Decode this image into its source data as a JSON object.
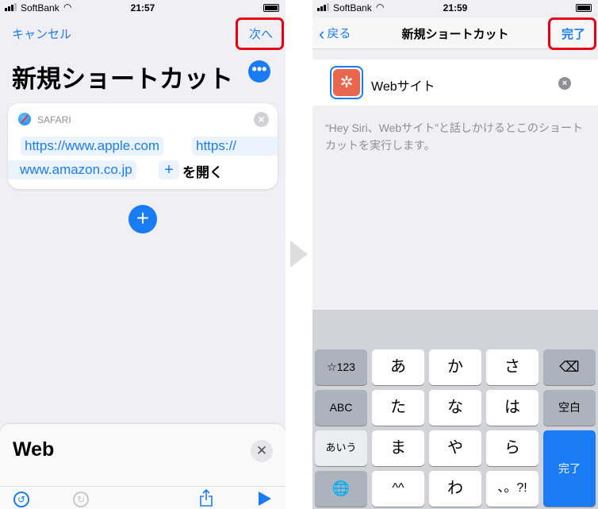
{
  "left": {
    "status": {
      "carrier": "SoftBank",
      "time": "21:57"
    },
    "nav": {
      "cancel": "キャンセル",
      "next": "次へ"
    },
    "title": "新規ショートカット",
    "more_icon": "ellipsis-icon",
    "action": {
      "app": "SAFARI",
      "tokens": [
        "https://www.apple.com",
        "https://",
        "www.amazon.co.jp",
        "+"
      ],
      "verb": "を開く"
    },
    "add_icon": "plus-icon",
    "sheet": {
      "title": "Web",
      "toolbar": [
        "undo-icon",
        "redo-icon",
        "share-icon",
        "play-icon"
      ]
    }
  },
  "right": {
    "status": {
      "carrier": "SoftBank",
      "time": "21:59"
    },
    "nav": {
      "back": "戻る",
      "title": "新規ショートカット",
      "done": "完了"
    },
    "shortcut_name": "Webサイト",
    "icon_glyph": "✲",
    "hint": "“Hey Siri、Webサイト”と話しかけるとこのショートカットを実行します。",
    "keyboard": {
      "rows": [
        [
          "☆123",
          "あ",
          "か",
          "さ",
          "⌫"
        ],
        [
          "ABC",
          "た",
          "な",
          "は",
          "空白"
        ],
        [
          "あいう",
          "ま",
          "や",
          "ら"
        ],
        [
          "🌐",
          "^^",
          "わ",
          "、。?!"
        ]
      ],
      "return": "完了"
    }
  },
  "colors": {
    "accent": "#1a7cf5",
    "highlight": "#e60012",
    "app_icon": "#e8664e"
  }
}
